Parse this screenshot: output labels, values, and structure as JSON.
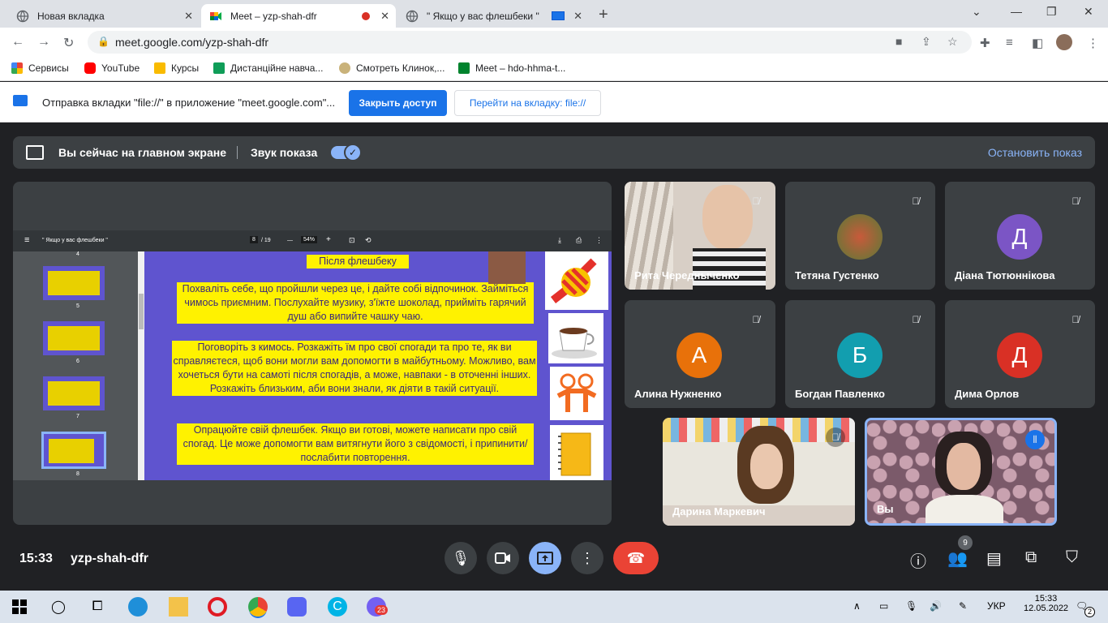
{
  "browser": {
    "tabs": [
      {
        "title": "Новая вкладка"
      },
      {
        "title": "Meet – yzp-shah-dfr"
      },
      {
        "title": "\" Якщо у вас флешбеки \""
      }
    ],
    "url": "meet.google.com/yzp-shah-dfr",
    "bookmarks": [
      {
        "label": "Сервисы"
      },
      {
        "label": "YouTube"
      },
      {
        "label": "Курсы"
      },
      {
        "label": "Дистанційне навча..."
      },
      {
        "label": "Смотреть Клинок,..."
      },
      {
        "label": "Meet – hdo-hhma-t..."
      }
    ],
    "infobar": {
      "message": "Отправка вкладки \"file://\" в приложение \"meet.google.com\"...",
      "primary": "Закрыть доступ",
      "secondary": "Перейти на вкладку: file://"
    }
  },
  "meet": {
    "banner": {
      "title": "Вы сейчас на главном экране",
      "sound": "Звук показа",
      "stop": "Остановить показ"
    },
    "pdf": {
      "title": "\" Якщо у вас флешбеки \"",
      "page": "8",
      "pages": "/ 19",
      "zoom": "54%",
      "thumb_numbers": [
        "4",
        "5",
        "6",
        "7",
        "8"
      ]
    },
    "slide": {
      "heading": "Після флешбеку",
      "p1": "Похваліть себе, що пройшли через це, і дайте собі відпочинок. Займіться чимось приємним. Послухайте музику, з'їжте шоколад, прийміть гарячий душ або  випийте чашку чаю.",
      "p2": "Поговоріть з кимось. Розкажіть їм про свої спогади та про те, як ви справляєтеся, щоб вони могли вам допомогти в майбутньому. Можливо, вам хочеться бути на самоті після спогадів, а може, навпаки -  в оточенні інших. Розкажіть близьким, аби вони знали, як діяти в такій ситуації.",
      "p3": "Опрацюйте свій флешбек. Якщо ви готові, можете написати про свій спогад. Це може допомогти вам витягнути його з свідомості, і припинити/послабити повторення."
    },
    "participants": [
      {
        "name": "Рита Чередныченко"
      },
      {
        "name": "Тетяна Густенко"
      },
      {
        "name": "Діана Тютюннікова",
        "initial": "Д",
        "color": "#7b55c5"
      },
      {
        "name": "Алина Нужненко",
        "initial": "А",
        "color": "#e8710a"
      },
      {
        "name": "Богдан Павленко",
        "initial": "Б",
        "color": "#129eaf"
      },
      {
        "name": "Дима Орлов",
        "initial": "Д",
        "color": "#d93025"
      },
      {
        "name": "Дарина Маркевич"
      },
      {
        "name": "Вы"
      }
    ],
    "footer": {
      "time": "15:33",
      "code": "yzp-shah-dfr",
      "people_count": "9"
    }
  },
  "taskbar": {
    "lang": "УКР",
    "time": "15:33",
    "date": "12.05.2022",
    "viber_badge": "23",
    "notif_count": "2"
  }
}
